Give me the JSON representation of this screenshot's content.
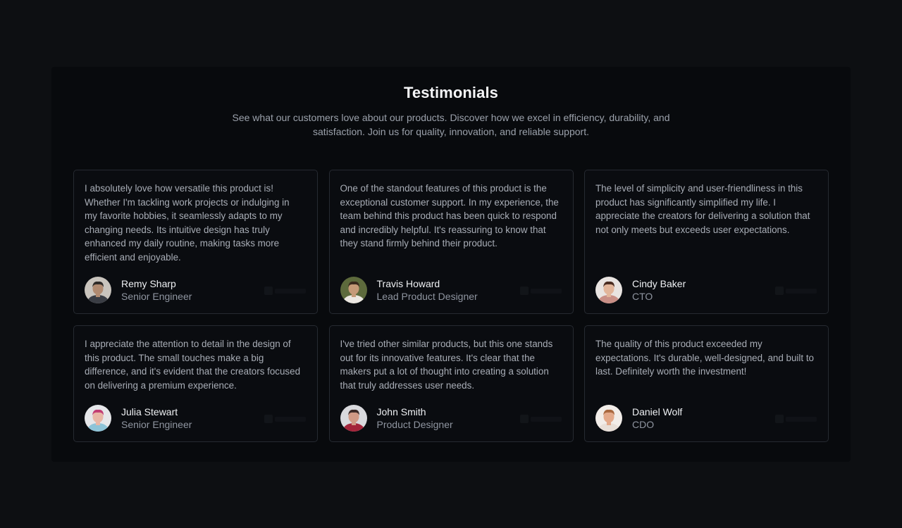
{
  "header": {
    "title": "Testimonials",
    "subtitle": "See what our customers love about our products. Discover how we excel in efficiency, durability, and satisfaction. Join us for quality, innovation, and reliable support."
  },
  "testimonials": [
    {
      "quote": "I absolutely love how versatile this product is! Whether I'm tackling work projects or indulging in my favorite hobbies, it seamlessly adapts to my changing needs. Its intuitive design has truly enhanced my daily routine, making tasks more efficient and enjoyable.",
      "name": "Remy Sharp",
      "role": "Senior Engineer",
      "avatar_colors": {
        "bg": "#c9c4bd",
        "skin": "#b08a70",
        "hair": "#2e2a27",
        "shirt": "#3a3d44"
      }
    },
    {
      "quote": "One of the standout features of this product is the exceptional customer support. In my experience, the team behind this product has been quick to respond and incredibly helpful. It's reassuring to know that they stand firmly behind their product.",
      "name": "Travis Howard",
      "role": "Lead Product Designer",
      "avatar_colors": {
        "bg": "#5d6a3c",
        "skin": "#c59a78",
        "hair": "#3a2a1e",
        "shirt": "#ece8e2"
      }
    },
    {
      "quote": "The level of simplicity and user-friendliness in this product has significantly simplified my life. I appreciate the creators for delivering a solution that not only meets but exceeds user expectations.",
      "name": "Cindy Baker",
      "role": "CTO",
      "avatar_colors": {
        "bg": "#e9e4e1",
        "skin": "#e2b59a",
        "hair": "#4a2c20",
        "shirt": "#c98f86"
      }
    },
    {
      "quote": "I appreciate the attention to detail in the design of this product. The small touches make a big difference, and it's evident that the creators focused on delivering a premium experience.",
      "name": "Julia Stewart",
      "role": "Senior Engineer",
      "avatar_colors": {
        "bg": "#e6e7ea",
        "skin": "#e8b6a6",
        "hair": "#c23d74",
        "shirt": "#8ec4d8"
      }
    },
    {
      "quote": "I've tried other similar products, but this one stands out for its innovative features. It's clear that the makers put a lot of thought into creating a solution that truly addresses user needs.",
      "name": "John Smith",
      "role": "Product Designer",
      "avatar_colors": {
        "bg": "#d9d9dd",
        "skin": "#d09a86",
        "hair": "#3b2a27",
        "shirt": "#a3243a"
      }
    },
    {
      "quote": "The quality of this product exceeded my expectations. It's durable, well-designed, and built to last. Definitely worth the investment!",
      "name": "Daniel Wolf",
      "role": "CDO",
      "avatar_colors": {
        "bg": "#f2ede9",
        "skin": "#e3a98a",
        "hair": "#a9683f",
        "shirt": "#e8dfd8"
      }
    }
  ]
}
